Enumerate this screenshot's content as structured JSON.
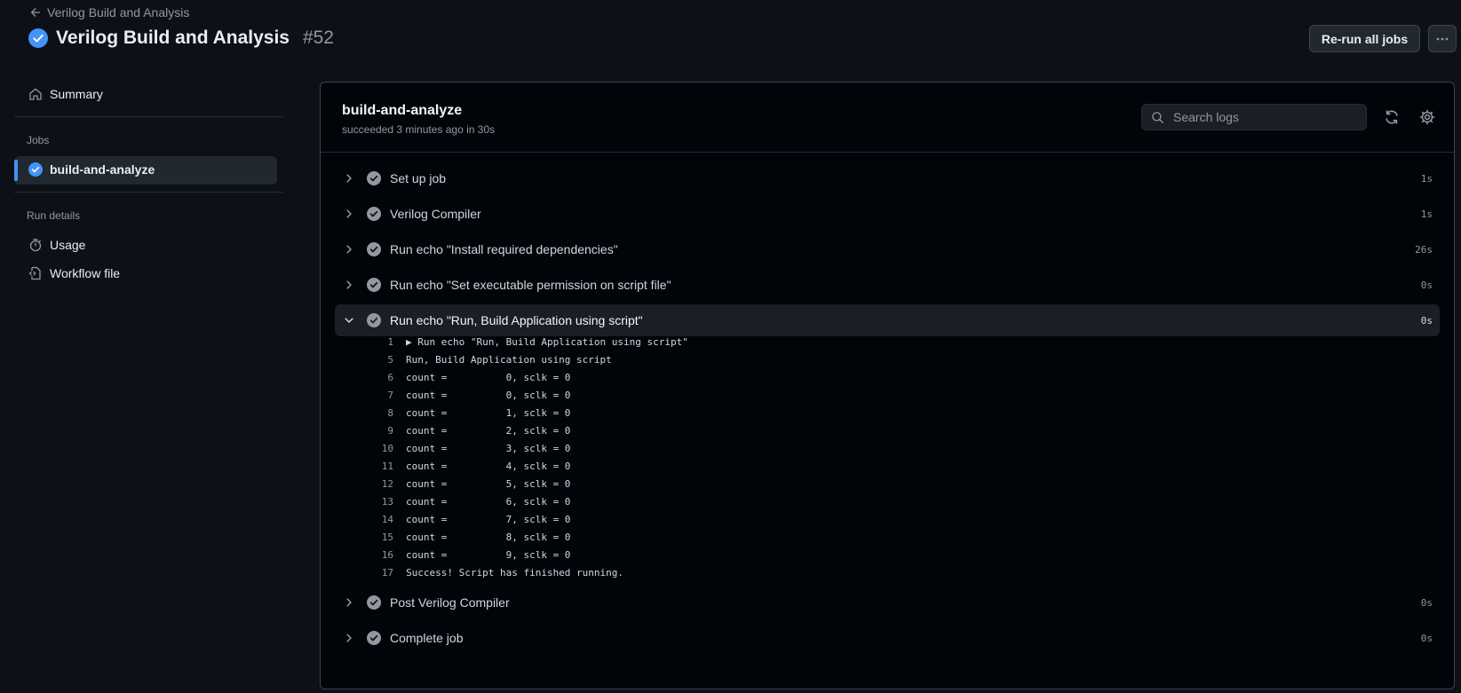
{
  "header": {
    "back_label": "Verilog Build and Analysis",
    "title": "Verilog Build and Analysis",
    "run_number": "#52",
    "rerun_label": "Re-run all jobs"
  },
  "sidebar": {
    "summary_label": "Summary",
    "jobs_heading": "Jobs",
    "job_label": "build-and-analyze",
    "run_details_heading": "Run details",
    "usage_label": "Usage",
    "workflow_label": "Workflow file"
  },
  "job": {
    "title": "build-and-analyze",
    "subtitle": "succeeded 3 minutes ago in 30s",
    "search_placeholder": "Search logs"
  },
  "steps": [
    {
      "label": "Set up job",
      "time": "1s"
    },
    {
      "label": "Verilog Compiler",
      "time": "1s"
    },
    {
      "label": "Run echo \"Install required dependencies\"",
      "time": "26s"
    },
    {
      "label": "Run echo \"Set executable permission on script file\"",
      "time": "0s"
    },
    {
      "label": "Run echo \"Run, Build Application using script\"",
      "time": "0s"
    },
    {
      "label": "Post Verilog Compiler",
      "time": "0s"
    },
    {
      "label": "Complete job",
      "time": "0s"
    }
  ],
  "log": [
    {
      "n": "1",
      "text": "▶ Run echo \"Run, Build Application using script\""
    },
    {
      "n": "5",
      "text": "Run, Build Application using script"
    },
    {
      "n": "6",
      "text": "count =          0, sclk = 0"
    },
    {
      "n": "7",
      "text": "count =          0, sclk = 0"
    },
    {
      "n": "8",
      "text": "count =          1, sclk = 0"
    },
    {
      "n": "9",
      "text": "count =          2, sclk = 0"
    },
    {
      "n": "10",
      "text": "count =          3, sclk = 0"
    },
    {
      "n": "11",
      "text": "count =          4, sclk = 0"
    },
    {
      "n": "12",
      "text": "count =          5, sclk = 0"
    },
    {
      "n": "13",
      "text": "count =          6, sclk = 0"
    },
    {
      "n": "14",
      "text": "count =          7, sclk = 0"
    },
    {
      "n": "15",
      "text": "count =          8, sclk = 0"
    },
    {
      "n": "16",
      "text": "count =          9, sclk = 0"
    },
    {
      "n": "17",
      "text": "Success! Script has finished running."
    }
  ],
  "colors": {
    "background": "#0d1117",
    "panel": "#010409",
    "accent": "#4493f8",
    "success_check": "#9198a1"
  }
}
